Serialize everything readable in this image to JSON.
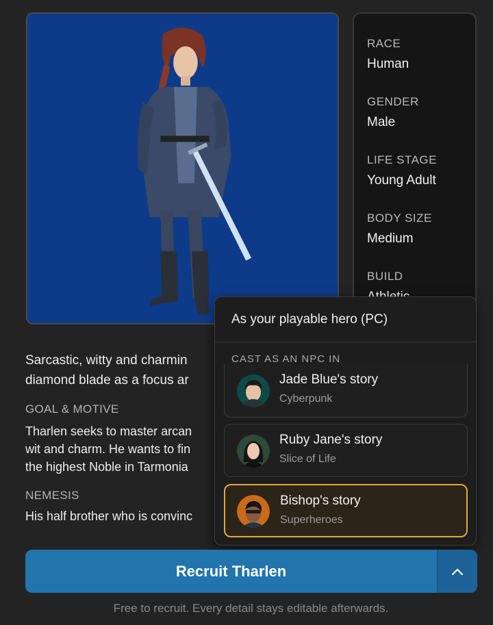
{
  "portrait": {
    "alt": "Tharlen character portrait",
    "background": "#0e3a8a"
  },
  "stats": [
    {
      "label": "RACE",
      "value": "Human"
    },
    {
      "label": "GENDER",
      "value": "Male"
    },
    {
      "label": "LIFE STAGE",
      "value": "Young Adult"
    },
    {
      "label": "BODY SIZE",
      "value": "Medium"
    },
    {
      "label": "BUILD",
      "value": "Athletic"
    }
  ],
  "description": {
    "line1": "Sarcastic, witty and charmin",
    "line2": "diamond blade as a focus ar"
  },
  "goal": {
    "label": "GOAL & MOTIVE",
    "line1": "Tharlen seeks to master arcan",
    "line2": "wit and charm. He wants to fin",
    "line3": "the highest Noble in Tarmonia"
  },
  "nemesis": {
    "label": "NEMESIS",
    "line1": "His half brother who is convinc"
  },
  "menu": {
    "pc_option": "As your playable hero (PC)",
    "npc_label": "CAST AS AN NPC IN",
    "stories": [
      {
        "title": "Jade Blue's story",
        "genre": "Cyberpunk",
        "selected": false
      },
      {
        "title": "Ruby Jane's story",
        "genre": "Slice of Life",
        "selected": false
      },
      {
        "title": "Bishop's story",
        "genre": "Superheroes",
        "selected": true
      }
    ]
  },
  "recruit": {
    "label": "Recruit Tharlen",
    "toggle_icon": "chevron-up-icon"
  },
  "footnote": "Free to recruit. Every detail stays editable afterwards.",
  "colors": {
    "accent": "#2274ad",
    "selected_border": "#e1a93a",
    "background": "#232323"
  }
}
